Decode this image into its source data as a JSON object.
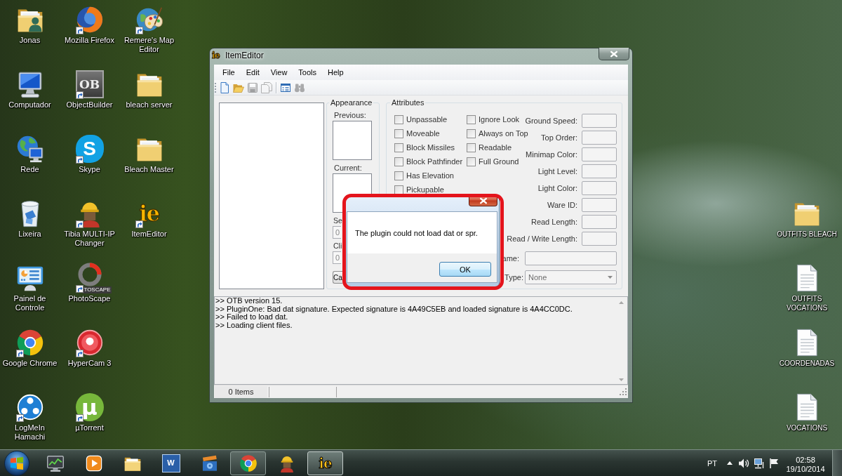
{
  "desktop": {
    "icon_columns": [
      [
        {
          "label": "Jonas",
          "kind": "user-folder",
          "shortcut": false
        },
        {
          "label": "Computador",
          "kind": "computer",
          "shortcut": false
        },
        {
          "label": "Rede",
          "kind": "network",
          "shortcut": false
        },
        {
          "label": "Lixeira",
          "kind": "trash-bin",
          "shortcut": false
        },
        {
          "label": "Painel de Controle",
          "kind": "control-panel",
          "shortcut": false
        },
        {
          "label": "Google Chrome",
          "kind": "circle-logo",
          "shortcut": true
        },
        {
          "label": "LogMeIn Hamachi",
          "kind": "dots-circle",
          "shortcut": true
        }
      ],
      [
        {
          "label": "Mozilla Firefox",
          "kind": "globe-logo",
          "shortcut": true
        },
        {
          "label": "ObjectBuilder",
          "kind": "letter-tile",
          "glyph": "OB",
          "shortcut": true
        },
        {
          "label": "Skype",
          "kind": "letter-cloud",
          "glyph": "S",
          "shortcut": true
        },
        {
          "label": "Tibia MULTI-IP Changer",
          "kind": "helmet-figure",
          "shortcut": true
        },
        {
          "label": "PhotoScape",
          "kind": "ring-logo",
          "glyph": "TOSCAPE",
          "shortcut": true
        },
        {
          "label": "HyperCam 3",
          "kind": "record-button",
          "shortcut": true
        },
        {
          "label": "µTorrent",
          "kind": "letter-circle",
          "glyph": "µ",
          "shortcut": true
        }
      ],
      [
        {
          "label": "Remere's Map Editor",
          "kind": "palette-globe",
          "shortcut": true
        },
        {
          "label": "bleach server",
          "kind": "folder",
          "shortcut": false
        },
        {
          "label": "Bleach Master",
          "kind": "folder",
          "shortcut": false
        },
        {
          "label": "ItemEditor",
          "kind": "letter-logo",
          "glyph": "ie",
          "shortcut": true
        }
      ]
    ],
    "right_icons": [
      {
        "label": "OUTFITS BLEACH",
        "kind": "folder",
        "shortcut": false
      },
      {
        "label": "OUTFITS VOCATIONS",
        "kind": "document",
        "shortcut": false
      },
      {
        "label": "COORDENADAS",
        "kind": "document",
        "shortcut": false
      },
      {
        "label": "VOCATIONS",
        "kind": "document",
        "shortcut": false
      }
    ]
  },
  "item_editor": {
    "title": "ItemEditor",
    "title_glyph": "ie",
    "menu": [
      "File",
      "Edit",
      "View",
      "Tools",
      "Help"
    ],
    "toolbar_groups": [
      [
        {
          "kind": "new-document",
          "disabled": false
        },
        {
          "kind": "open-folder",
          "disabled": false
        },
        {
          "kind": "save",
          "disabled": true
        },
        {
          "kind": "save-copies",
          "disabled": true
        }
      ],
      [
        {
          "kind": "properties",
          "disabled": false
        },
        {
          "kind": "binoculars",
          "disabled": true
        }
      ]
    ],
    "appearance": {
      "title": "Appearance",
      "previous_label": "Previous:",
      "current_label": "Current:",
      "server_id_label": "Se",
      "server_id": "0",
      "client_id_label": "Cli",
      "client_id": "0",
      "button": "Ca"
    },
    "attributes": {
      "title": "Attributes",
      "flags": [
        [
          {
            "label": "Unpassable",
            "checked": false
          },
          {
            "label": "Moveable",
            "checked": false
          },
          {
            "label": "Block Missiles",
            "checked": false
          },
          {
            "label": "Block Pathfinder",
            "checked": false
          },
          {
            "label": "Has Elevation",
            "checked": false
          },
          {
            "label": "Pickupable",
            "checked": false
          }
        ],
        [
          {
            "label": "Ignore Look",
            "checked": false
          },
          {
            "label": "Always on Top",
            "checked": false
          },
          {
            "label": "Readable",
            "checked": false
          },
          {
            "label": "Full Ground",
            "checked": false
          }
        ]
      ],
      "fields": [
        {
          "label": "Ground Speed:"
        },
        {
          "label": "Top Order:"
        },
        {
          "label": "Minimap Color:"
        },
        {
          "label": "Light Level:"
        },
        {
          "label": "Light Color:"
        },
        {
          "label": "Ware ID:"
        },
        {
          "label": "Read Length:"
        },
        {
          "label": "Read / Write Length:"
        }
      ],
      "name_label": "ame:",
      "type_label": "Type:",
      "type_value": "None"
    },
    "log": [
      ">> OTB version 15.",
      ">> PluginOne: Bad dat signature. Expected signature is 4A49C5EB and loaded signature is 4A4CC0DC.",
      ">> Failed to load dat.",
      ">> Loading client files."
    ],
    "status_bar": {
      "item_count": "0 Items"
    }
  },
  "dialog": {
    "message": "The plugin could not load dat or spr.",
    "buttons": [
      {
        "label": "OK",
        "focused": true
      }
    ]
  },
  "annotation": {
    "kind": "rounded-outline"
  },
  "taskbar": {
    "items": [
      {
        "kind": "monitor",
        "running": false,
        "selected": false
      },
      {
        "kind": "play",
        "running": false,
        "selected": false
      },
      {
        "kind": "folders",
        "running": false,
        "selected": false
      },
      {
        "kind": "letter-tile",
        "glyph": "W",
        "running": false,
        "selected": false
      },
      {
        "kind": "clapperboard",
        "running": false,
        "selected": false
      },
      {
        "kind": "circle-logo",
        "running": true,
        "selected": false
      },
      {
        "kind": "helmet-figure",
        "running": false,
        "selected": false
      },
      {
        "kind": "letter-logo",
        "glyph": "ie",
        "running": true,
        "selected": true
      }
    ],
    "tray": {
      "language": "PT",
      "icons": [
        {
          "kind": "caret-up"
        },
        {
          "kind": "speaker"
        },
        {
          "kind": "network"
        },
        {
          "kind": "flag"
        }
      ],
      "time": "02:58",
      "date": "19/10/2014"
    }
  }
}
